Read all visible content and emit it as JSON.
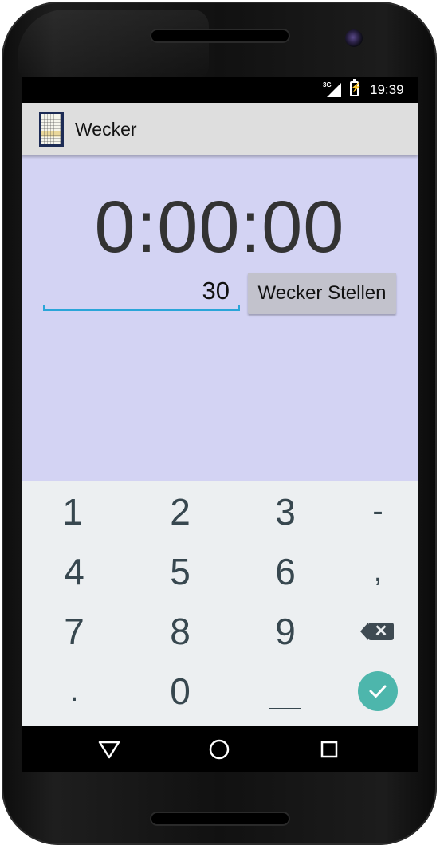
{
  "status_bar": {
    "network": "3G",
    "charging_glyph": "⚡",
    "time": "19:39"
  },
  "action_bar": {
    "app_icon": "wecker-app-icon",
    "title": "Wecker"
  },
  "main": {
    "timer_display": "0:00:00",
    "minutes_input_value": "30",
    "set_button_label": "Wecker Stellen",
    "background_color": "#d3d3f3",
    "accent_color": "#2aa5d8"
  },
  "keypad": {
    "row1": [
      "1",
      "2",
      "3",
      "-"
    ],
    "row2": [
      "4",
      "5",
      "6",
      ","
    ],
    "row3": [
      "7",
      "8",
      "9"
    ],
    "row4": [
      ".",
      "0"
    ],
    "backspace_icon": "backspace-icon",
    "space_icon": "underscore-space-icon",
    "done_icon": "check-icon",
    "done_color": "#4db6ac"
  },
  "nav_bar": {
    "back_icon": "back-triangle-icon",
    "home_icon": "home-circle-icon",
    "recents_icon": "recents-square-icon"
  }
}
